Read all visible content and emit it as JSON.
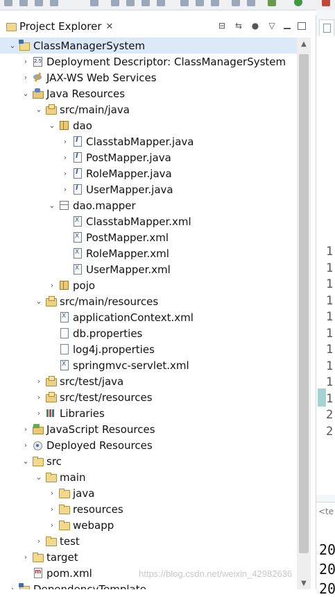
{
  "view": {
    "title": "Project Explorer",
    "close_glyph": "✕"
  },
  "tree": [
    {
      "label": "ClassManagerSystem",
      "icon": "project-icon",
      "depth": 0,
      "state": "open",
      "selected": true
    },
    {
      "label": "Deployment Descriptor: ClassManagerSystem",
      "icon": "descriptor-icon",
      "depth": 1,
      "state": "closed"
    },
    {
      "label": "JAX-WS Web Services",
      "icon": "webservices-icon",
      "depth": 1,
      "state": "closed"
    },
    {
      "label": "Java Resources",
      "icon": "java-resources-icon",
      "depth": 1,
      "state": "open"
    },
    {
      "label": "src/main/java",
      "icon": "source-folder-icon",
      "depth": 2,
      "state": "open"
    },
    {
      "label": "dao",
      "icon": "package-icon",
      "depth": 3,
      "state": "open"
    },
    {
      "label": "ClasstabMapper.java",
      "icon": "java-interface-icon",
      "depth": 4,
      "state": "closed"
    },
    {
      "label": "PostMapper.java",
      "icon": "java-interface-icon",
      "depth": 4,
      "state": "closed"
    },
    {
      "label": "RoleMapper.java",
      "icon": "java-interface-icon",
      "depth": 4,
      "state": "closed"
    },
    {
      "label": "UserMapper.java",
      "icon": "java-interface-icon",
      "depth": 4,
      "state": "closed"
    },
    {
      "label": "dao.mapper",
      "icon": "package-open-icon",
      "depth": 3,
      "state": "open"
    },
    {
      "label": "ClasstabMapper.xml",
      "icon": "xml-file-icon",
      "depth": 4,
      "state": "leaf"
    },
    {
      "label": "PostMapper.xml",
      "icon": "xml-file-icon",
      "depth": 4,
      "state": "leaf"
    },
    {
      "label": "RoleMapper.xml",
      "icon": "xml-file-icon",
      "depth": 4,
      "state": "leaf"
    },
    {
      "label": "UserMapper.xml",
      "icon": "xml-file-icon",
      "depth": 4,
      "state": "leaf"
    },
    {
      "label": "pojo",
      "icon": "package-icon",
      "depth": 3,
      "state": "closed"
    },
    {
      "label": "src/main/resources",
      "icon": "source-folder-icon",
      "depth": 2,
      "state": "open"
    },
    {
      "label": "applicationContext.xml",
      "icon": "xml-file-icon",
      "depth": 3,
      "state": "leaf"
    },
    {
      "label": "db.properties",
      "icon": "file-icon",
      "depth": 3,
      "state": "leaf"
    },
    {
      "label": "log4j.properties",
      "icon": "file-icon",
      "depth": 3,
      "state": "leaf"
    },
    {
      "label": "springmvc-servlet.xml",
      "icon": "xml-file-icon",
      "depth": 3,
      "state": "leaf"
    },
    {
      "label": "src/test/java",
      "icon": "source-folder-icon",
      "depth": 2,
      "state": "closed"
    },
    {
      "label": "src/test/resources",
      "icon": "source-folder-icon",
      "depth": 2,
      "state": "closed"
    },
    {
      "label": "Libraries",
      "icon": "libraries-icon",
      "depth": 2,
      "state": "closed"
    },
    {
      "label": "JavaScript Resources",
      "icon": "js-resources-icon",
      "depth": 1,
      "state": "closed"
    },
    {
      "label": "Deployed Resources",
      "icon": "deployed-resources-icon",
      "depth": 1,
      "state": "closed"
    },
    {
      "label": "src",
      "icon": "folder-icon",
      "depth": 1,
      "state": "open"
    },
    {
      "label": "main",
      "icon": "folder-icon",
      "depth": 2,
      "state": "open"
    },
    {
      "label": "java",
      "icon": "folder-icon",
      "depth": 3,
      "state": "closed"
    },
    {
      "label": "resources",
      "icon": "folder-icon",
      "depth": 3,
      "state": "closed"
    },
    {
      "label": "webapp",
      "icon": "folder-icon",
      "depth": 3,
      "state": "closed"
    },
    {
      "label": "test",
      "icon": "folder-icon",
      "depth": 2,
      "state": "closed"
    },
    {
      "label": "target",
      "icon": "folder-icon",
      "depth": 1,
      "state": "closed"
    },
    {
      "label": "pom.xml",
      "icon": "pom-file-icon",
      "depth": 1,
      "state": "leaf"
    },
    {
      "label": "DependencyTemplate",
      "icon": "project-icon",
      "depth": 0,
      "state": "closed"
    }
  ],
  "editor": {
    "line_numbers": [
      "1",
      "1",
      "1",
      "1",
      "1",
      "1",
      "1",
      "1",
      "1",
      "1",
      "2",
      "2"
    ],
    "bottom_tab_char": "<te",
    "bottom_lines": [
      "20",
      "20",
      "20"
    ]
  },
  "watermark": "https://blog.csdn.net/weixin_42982636"
}
